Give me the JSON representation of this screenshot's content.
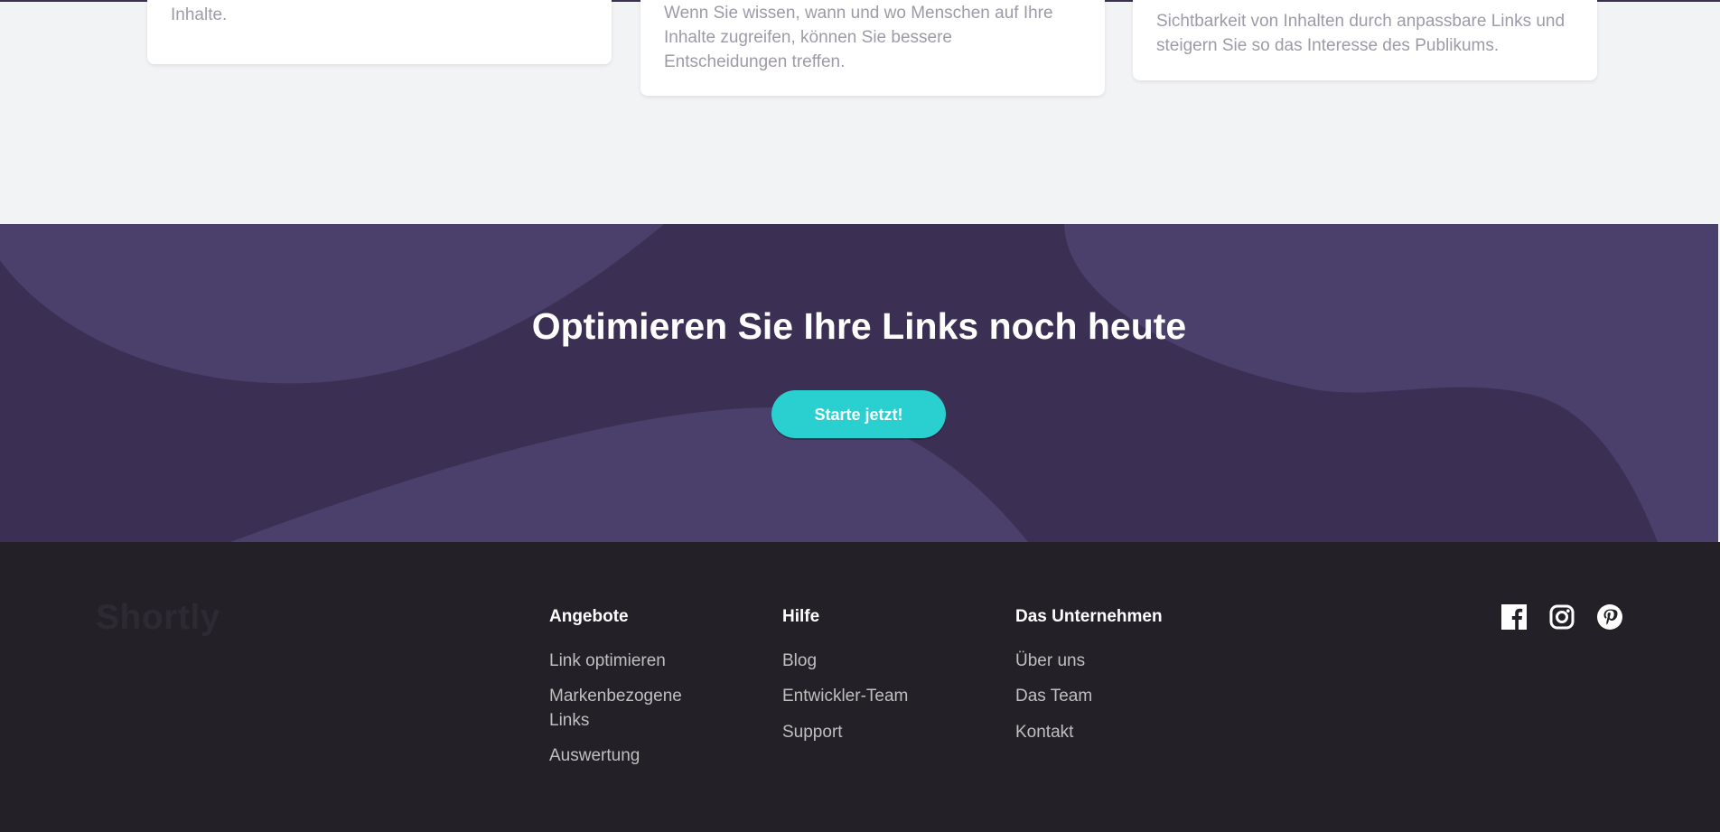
{
  "cards": [
    {
      "text": "Markenbezogene Links schaffen Vertrauen in Ihre Inhalte."
    },
    {
      "text": "Wenn Sie wissen, wann und wo Menschen auf Ihre Inhalte zugreifen, können Sie bessere Entscheidungen treffen."
    },
    {
      "text": "Sichtbarkeit von Inhalten durch anpassbare Links und steigern Sie so das Interesse des Publikums."
    }
  ],
  "cta": {
    "title": "Optimieren Sie Ihre Links noch heute",
    "button": "Starte jetzt!"
  },
  "footer": {
    "logo": "Shortly",
    "columns": [
      {
        "heading": "Angebote",
        "links": [
          "Link optimieren",
          "Markenbezogene Links",
          "Auswertung"
        ]
      },
      {
        "heading": "Hilfe",
        "links": [
          "Blog",
          "Entwickler-Team",
          "Support"
        ]
      },
      {
        "heading": "Das Unternehmen",
        "links": [
          "Über uns",
          "Das Team",
          "Kontakt"
        ]
      }
    ],
    "social_icons": [
      "facebook-icon",
      "instagram-icon",
      "pinterest-icon"
    ]
  },
  "colors": {
    "primary": "#2acfcf",
    "dark_violet": "#3b3054",
    "footer_bg": "#232127",
    "page_bg": "#f2f3f5"
  }
}
